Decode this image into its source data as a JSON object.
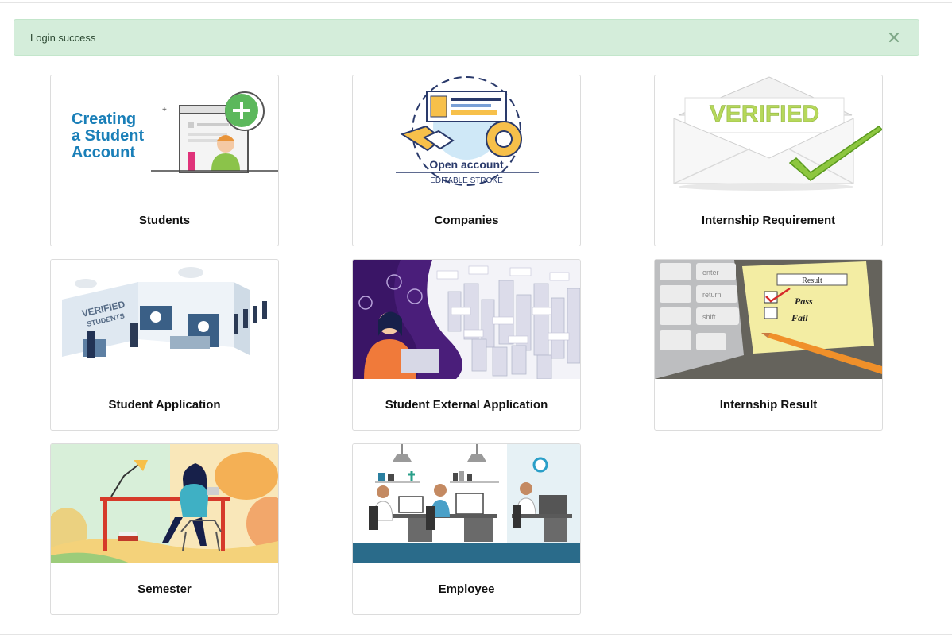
{
  "alert": {
    "message": "Login success",
    "close_icon": "close-icon",
    "color": "#d4edda"
  },
  "cards": [
    {
      "title": "Students",
      "image_text": {
        "line1": "Creating",
        "line2": "a Student",
        "line3": "Account"
      }
    },
    {
      "title": "Companies",
      "image_text": {
        "line1": "Open account",
        "line2": "EDITABLE STROKE"
      }
    },
    {
      "title": "Internship Requirement",
      "image_text": {
        "line1": "VERIFIED"
      }
    },
    {
      "title": "Student Application",
      "image_text": {
        "line1": "VERIFIED",
        "line2": "STUDENTS"
      }
    },
    {
      "title": "Student External Application"
    },
    {
      "title": "Internship Result",
      "image_text": {
        "result": "Result",
        "pass": "Pass",
        "fail": "Fail",
        "key1": "enter",
        "key2": "return",
        "key3": "shift"
      }
    },
    {
      "title": "Semester"
    },
    {
      "title": "Employee"
    }
  ]
}
